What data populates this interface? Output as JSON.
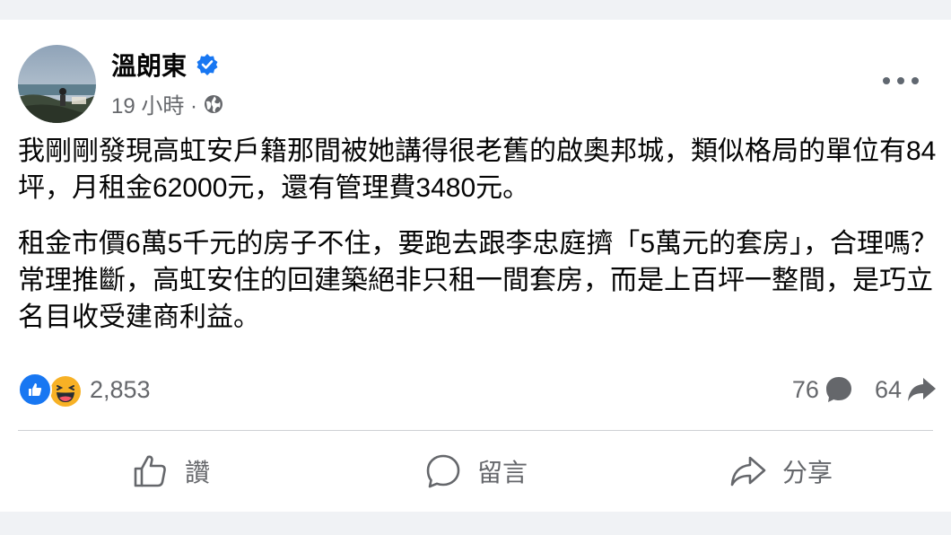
{
  "post": {
    "author": "溫朗東",
    "time": "19 小時 ·",
    "paragraphs": [
      "我剛剛發現高虹安戶籍那間被她講得很老舊的啟奧邦城，類似格局的單位有84坪，月租金62000元，還有管理費3480元。",
      "租金市價6萬5千元的房子不住，要跑去跟李忠庭擠「5萬元的套房」，合理嗎？常理推斷，高虹安住的回建築絕非只租一間套房，而是上百坪一整間，是巧立名目收受建商利益。"
    ],
    "icons": {
      "verified": "verified-badge-icon",
      "audience": "globe-icon",
      "menu": "more-options-icon"
    }
  },
  "stats": {
    "reaction_count": "2,853",
    "comment_count": "76",
    "share_count": "64",
    "reaction_types": [
      "like",
      "haha"
    ]
  },
  "actions": {
    "like_label": "讚",
    "comment_label": "留言",
    "share_label": "分享"
  },
  "colors": {
    "background": "#f0f2f5",
    "card": "#ffffff",
    "accent": "#1877f2",
    "secondary_text": "#65676b"
  }
}
